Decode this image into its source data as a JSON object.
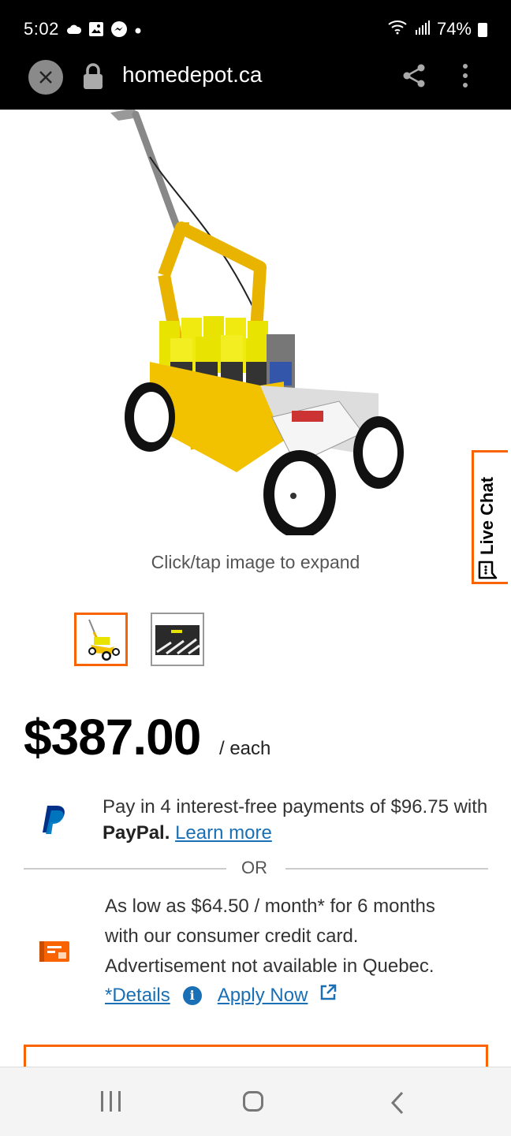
{
  "status": {
    "time": "5:02",
    "battery": "74%"
  },
  "browser": {
    "url": "homedepot.ca"
  },
  "product": {
    "expand_hint": "Click/tap image to expand"
  },
  "live_chat": {
    "label": "Live Chat"
  },
  "price": {
    "amount": "$387.00",
    "unit": "/ each"
  },
  "paypal": {
    "text": "Pay in 4 interest-free payments of $96.75 with",
    "brand": "PayPal.",
    "learn_more": "Learn more"
  },
  "or_label": "OR",
  "credit": {
    "line1": "As low as $64.50 / month* for 6 months",
    "line2": "with our consumer credit card.",
    "line3": "Advertisement not available in Quebec.",
    "details": "*Details",
    "apply": "Apply Now"
  },
  "colors": {
    "accent": "#f96302",
    "link": "#1a6fb5",
    "paypal_dark": "#003087",
    "paypal_light": "#0079c1"
  }
}
